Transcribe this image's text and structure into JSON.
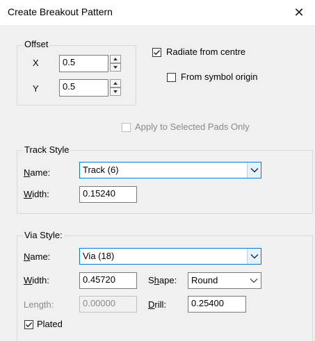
{
  "window": {
    "title": "Create Breakout Pattern",
    "close_glyph": "✕"
  },
  "offset": {
    "legend": "Offset",
    "x_label": "X",
    "x_value": "0.5",
    "y_label": "Y",
    "y_value": "0.5"
  },
  "radiate": {
    "label": "Radiate from centre",
    "checked": true
  },
  "from_origin": {
    "label": "From symbol origin",
    "checked": false
  },
  "apply_selected": {
    "label": "Apply to Selected Pads Only",
    "checked": false,
    "enabled": false
  },
  "track": {
    "legend": "Track Style",
    "name_label_u": "N",
    "name_label_rest": "ame:",
    "name_value": "Track (6)",
    "width_label_u": "W",
    "width_label_rest": "idth:",
    "width_value": "0.15240"
  },
  "via": {
    "legend": "Via Style:",
    "name_label_u": "N",
    "name_label_rest": "ame:",
    "name_value": "Via (18)",
    "width_label_u": "W",
    "width_label_rest": "idth:",
    "width_value": "0.45720",
    "shape_label_a": "S",
    "shape_label_u": "h",
    "shape_label_rest": "ape:",
    "shape_value": "Round",
    "length_label": "Length:",
    "length_value": "0.00000",
    "drill_label_u": "D",
    "drill_label_rest": "rill:",
    "drill_value": "0.25400",
    "plated_label": "Plated",
    "plated_checked": true
  },
  "colors": {
    "accent": "#0078d7",
    "background": "#f0f0f0"
  }
}
